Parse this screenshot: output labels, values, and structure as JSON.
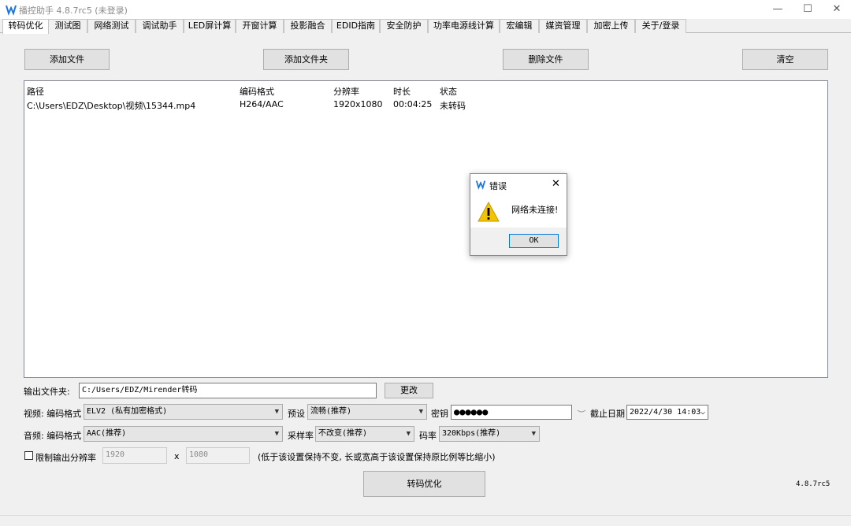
{
  "window": {
    "title": "播控助手 4.8.7rc5 (未登录)",
    "app_icon": "b-logo-icon",
    "minimize": "—",
    "maximize": "☐",
    "close": "✕"
  },
  "tabs": [
    {
      "label": "转码优化",
      "active": true
    },
    {
      "label": "测试图"
    },
    {
      "label": "网络测试"
    },
    {
      "label": "调试助手"
    },
    {
      "label": "LED屏计算"
    },
    {
      "label": "开窗计算"
    },
    {
      "label": "投影融合"
    },
    {
      "label": "EDID指南"
    },
    {
      "label": "安全防护"
    },
    {
      "label": "功率电源线计算"
    },
    {
      "label": "宏编辑"
    },
    {
      "label": "媒资管理"
    },
    {
      "label": "加密上传"
    },
    {
      "label": "关于/登录"
    }
  ],
  "toolbar": {
    "add_file": "添加文件",
    "add_folder": "添加文件夹",
    "delete_file": "删除文件",
    "clear": "清空"
  },
  "filelist": {
    "headers": [
      "路径",
      "编码格式",
      "分辨率",
      "时长",
      "状态"
    ],
    "rows": [
      [
        "C:\\Users\\EDZ\\Desktop\\视频\\15344.mp4",
        "H264/AAC",
        "1920x1080",
        "00:04:25",
        "未转码"
      ]
    ]
  },
  "output": {
    "label": "输出文件夹:",
    "path": "C:/Users/EDZ/Mirender转码",
    "change_button": "更改"
  },
  "video": {
    "label": "视频: 编码格式",
    "codec": "ELV2 (私有加密格式)",
    "preset_label": "预设",
    "preset": "流畅(推荐)",
    "key_label": "密钥",
    "key_value": "●●●●●●",
    "expire_label": "截止日期",
    "expire_date": "2022/4/30 14:03"
  },
  "audio": {
    "label": "音频: 编码格式",
    "codec": "AAC(推荐)",
    "samplerate_label": "采样率",
    "samplerate": "不改变(推荐)",
    "bitrate_label": "码率",
    "bitrate": "320Kbps(推荐)"
  },
  "resolution": {
    "checkbox_label": "限制输出分辨率",
    "checked": false,
    "width": "1920",
    "x": "x",
    "height": "1080",
    "note": "(低于该设置保持不变, 长或宽高于该设置保持原比例等比缩小)"
  },
  "transcode_button": "转码优化",
  "version": "4.8.7rc5",
  "dialog": {
    "title": "错误",
    "message": "网络未连接!",
    "ok": "OK",
    "icon": "warning-icon",
    "close": "✕"
  },
  "colors": {
    "accent": "#1a73e8",
    "warning": "#f2c300",
    "ok_border": "#0078d7"
  }
}
